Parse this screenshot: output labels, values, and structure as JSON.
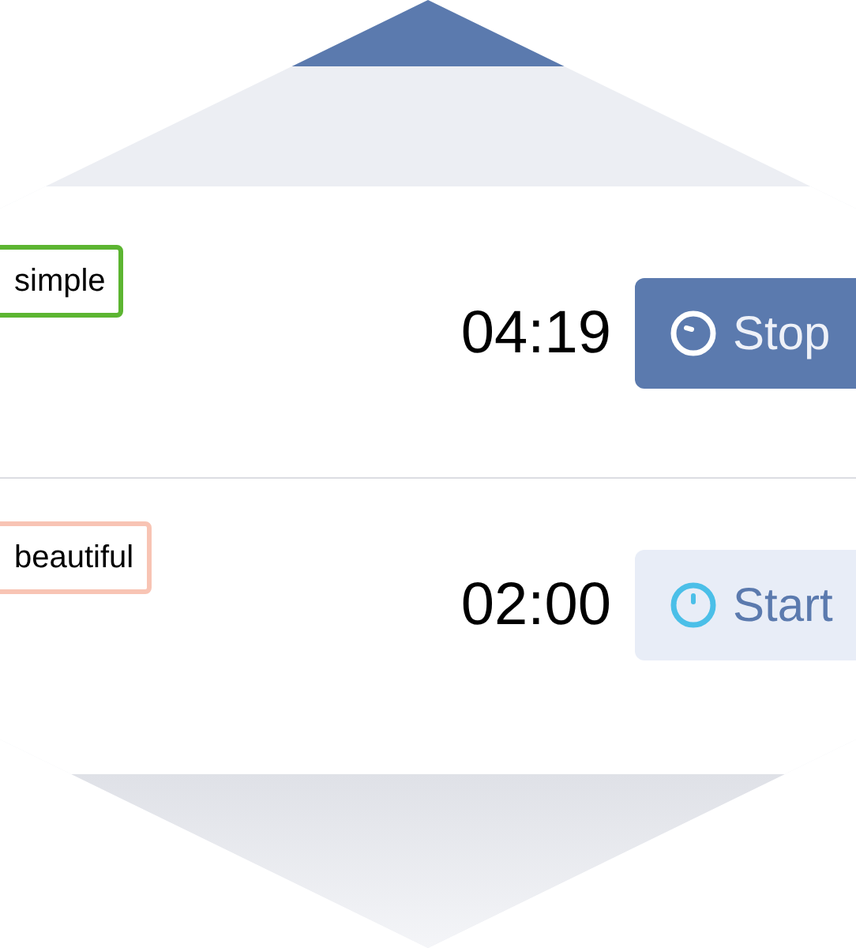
{
  "timers": [
    {
      "tag": "simple",
      "color": "#5cb531",
      "time": "04:19",
      "button": "Stop",
      "running": true
    },
    {
      "tag": "beautiful",
      "color": "#f8c4b4",
      "time": "02:00",
      "button": "Start",
      "running": false
    }
  ]
}
